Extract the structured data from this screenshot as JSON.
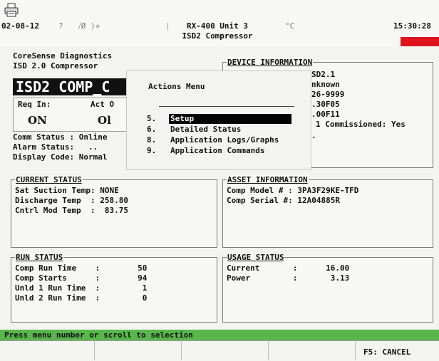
{
  "header": {
    "date": "02-08-12",
    "sym_q": "?",
    "sym_mid": "⧸Ø )✳",
    "sym_bar": "|",
    "title_line1": "RX-400 Unit 3",
    "title_line2": "ISD2 Compressor",
    "temp_unit_sym": "°C",
    "time": "15:30:28"
  },
  "diag": {
    "line1": "CoreSense Diagnostics",
    "line2": "ISD 2.0 Compressor",
    "big_title": "ISD2 COMP_C",
    "req_label": "Req In:",
    "act_label": "Act O",
    "req_value": "ON",
    "act_value": "Ol",
    "comm_status": "Comm Status : Online",
    "alarm_status": "Alarm Status:   ..",
    "display_code": "Display Code: Normal"
  },
  "device": {
    "title": "DEVICE INFORMATION",
    "lines": [
      "SD2.1",
      "nknown",
      "26-9999",
      ".30F05",
      ".00F11",
      "1 Commissioned: Yes",
      "."
    ]
  },
  "current_status": {
    "title": "CURRENT STATUS",
    "rows": [
      "Sat Suction Temp: NONE",
      "Discharge Temp  : 258.80",
      "Cntrl Mod Temp  :  83.75"
    ]
  },
  "asset": {
    "title": "ASSET INFORMATION",
    "rows": [
      "Comp Model # : 3PA3F29KE-TFD",
      "Comp Serial #: 12A04885R"
    ]
  },
  "run_status": {
    "title": "RUN STATUS",
    "rows": [
      "Comp Run Time    :        50",
      "Comp Starts      :        94",
      "Unld 1 Run Time  :         1",
      "Unld 2 Run Time  :         0"
    ]
  },
  "usage_status": {
    "title": "USAGE STATUS",
    "rows": [
      "Current       :      16.00",
      "Power         :       3.13"
    ]
  },
  "actions_menu": {
    "title": "Actions Menu",
    "items": [
      {
        "num": "5.",
        "label": "Setup",
        "selected": true
      },
      {
        "num": "6.",
        "label": "Detailed Status"
      },
      {
        "num": "8.",
        "label": "Application Logs/Graphs"
      },
      {
        "num": "9.",
        "label": "Application Commands"
      }
    ]
  },
  "footer": {
    "prompt": "Press menu number or scroll to selection",
    "f5_label": "F5: CANCEL"
  },
  "colors": {
    "alarm": "#e0141e",
    "status_bar": "#58b74a",
    "highlight": "#000000"
  }
}
